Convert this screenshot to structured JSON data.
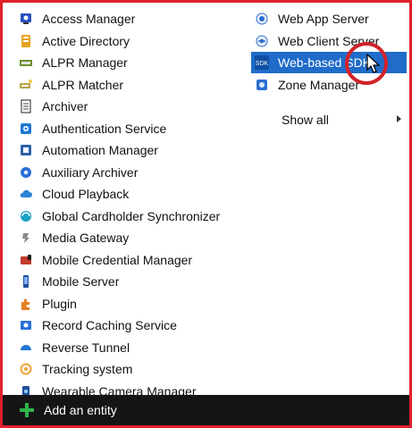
{
  "menu_left": {
    "items": [
      {
        "label": "Access Manager",
        "icon": "access-manager-icon",
        "color": "#2b4fbf"
      },
      {
        "label": "Active Directory",
        "icon": "active-directory-icon",
        "color": "#e6a31f"
      },
      {
        "label": "ALPR Manager",
        "icon": "alpr-manager-icon",
        "color": "#6b8f2a"
      },
      {
        "label": "ALPR Matcher",
        "icon": "alpr-matcher-icon",
        "color": "#b9a34a"
      },
      {
        "label": "Archiver",
        "icon": "archiver-icon",
        "color": "#444444"
      },
      {
        "label": "Authentication Service",
        "icon": "authentication-service-icon",
        "color": "#1f78d1"
      },
      {
        "label": "Automation Manager",
        "icon": "automation-manager-icon",
        "color": "#2c5fa8"
      },
      {
        "label": "Auxiliary Archiver",
        "icon": "auxiliary-archiver-icon",
        "color": "#2a6fd6"
      },
      {
        "label": "Cloud Playback",
        "icon": "cloud-playback-icon",
        "color": "#2d83d7"
      },
      {
        "label": "Global Cardholder Synchronizer",
        "icon": "global-cardholder-synchronizer-icon",
        "color": "#1aa3c4"
      },
      {
        "label": "Media Gateway",
        "icon": "media-gateway-icon",
        "color": "#8a8a8a"
      },
      {
        "label": "Mobile Credential Manager",
        "icon": "mobile-credential-manager-icon",
        "color": "#c0392b"
      },
      {
        "label": "Mobile Server",
        "icon": "mobile-server-icon",
        "color": "#1f4f9a"
      },
      {
        "label": "Plugin",
        "icon": "plugin-icon",
        "color": "#e67e22"
      },
      {
        "label": "Record Caching Service",
        "icon": "record-caching-service-icon",
        "color": "#2a6fd6"
      },
      {
        "label": "Reverse Tunnel",
        "icon": "reverse-tunnel-icon",
        "color": "#1f78d1"
      },
      {
        "label": "Tracking system",
        "icon": "tracking-system-icon",
        "color": "#f2a33a"
      },
      {
        "label": "Wearable Camera Manager",
        "icon": "wearable-camera-manager-icon",
        "color": "#1f4f9a"
      }
    ]
  },
  "menu_right": {
    "items": [
      {
        "label": "Web App Server",
        "icon": "web-app-server-icon",
        "color": "#2b6fd0"
      },
      {
        "label": "Web Client Server",
        "icon": "web-client-server-icon",
        "color": "#2b6fd0"
      },
      {
        "label": "Web-based SDK",
        "icon": "sdk-icon",
        "color": "#ffffff",
        "selected": true
      },
      {
        "label": "Zone Manager",
        "icon": "zone-manager-icon",
        "color": "#2b6fd0"
      }
    ],
    "show_all_label": "Show all"
  },
  "footer": {
    "add_label": "Add an entity"
  },
  "colors": {
    "highlight": "#1f6cc9",
    "frame": "#e0202a",
    "footer_bg": "#151515",
    "plus": "#2fb34b"
  }
}
